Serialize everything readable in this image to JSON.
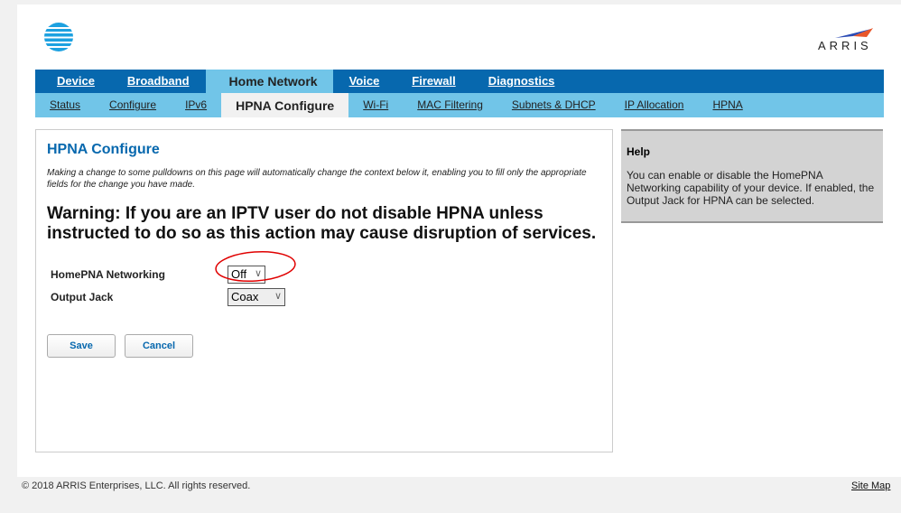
{
  "logos": {
    "att": "AT&T",
    "arris": "ARRIS"
  },
  "nav": {
    "items": [
      "Device",
      "Broadband",
      "Home Network",
      "Voice",
      "Firewall",
      "Diagnostics"
    ],
    "active": "Home Network"
  },
  "subnav": {
    "items": [
      "Status",
      "Configure",
      "IPv6",
      "HPNA Configure",
      "Wi-Fi",
      "MAC Filtering",
      "Subnets & DHCP",
      "IP Allocation",
      "HPNA"
    ],
    "active": "HPNA Configure"
  },
  "main": {
    "title": "HPNA Configure",
    "note": "Making a change to some pulldowns on this page will automatically change the context below it, enabling you to fill only the appropriate fields for the change you have made.",
    "warning": "Warning: If you are an IPTV user do not disable HPNA unless instructed to do so as this action may cause disruption of services.",
    "homepna_label": "HomePNA Networking",
    "homepna_value": "Off",
    "jack_label": "Output Jack",
    "jack_value": "Coax",
    "save": "Save",
    "cancel": "Cancel"
  },
  "help": {
    "title": "Help",
    "text": "You can enable or disable the HomePNA Networking capability of your device. If enabled, the Output Jack for HPNA can be selected."
  },
  "footer": {
    "copyright": "© 2018 ARRIS Enterprises, LLC. All rights reserved.",
    "sitemap": "Site Map"
  },
  "colors": {
    "brand": "#0768ae",
    "light": "#71c5e8",
    "annotation": "#e00000"
  }
}
